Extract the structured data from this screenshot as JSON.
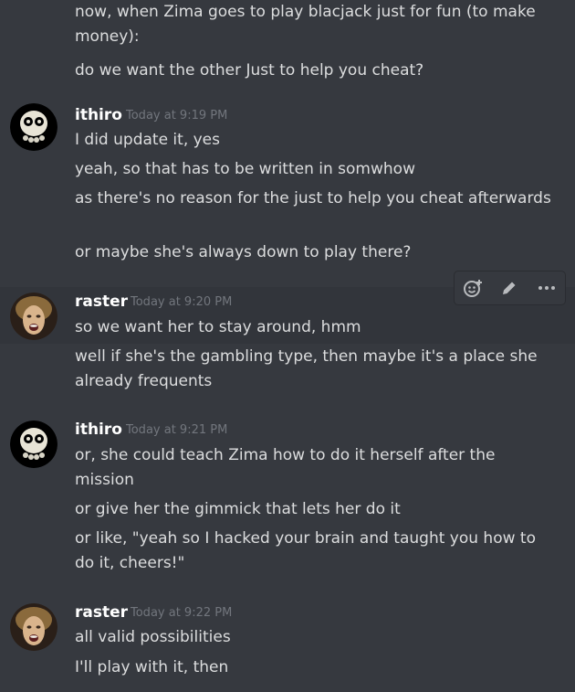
{
  "colors": {
    "background": "#36393f",
    "hover_background": "#32353b",
    "text": "#dcddde",
    "author": "#ffffff",
    "timestamp": "#72767d"
  },
  "messages": [
    {
      "author": "",
      "timestamp": "",
      "lines": [
        "now, when Zima goes to play blacjack just for fun (to make money):",
        "do we want the other Just to help you cheat?"
      ]
    },
    {
      "author": "ithiro",
      "timestamp": "Today at 9:19 PM",
      "avatar": "skull-avatar",
      "lines": [
        "I did update it, yes",
        "yeah, so that has to be written in somwhow",
        "as there's no reason for the just to help you cheat afterwards",
        "or maybe she's always down to play there?"
      ]
    },
    {
      "author": "raster",
      "timestamp": "Today at 9:20 PM",
      "avatar": "face-avatar",
      "lines": [
        "so we want her to stay around, hmm",
        "well if she's the gambling type, then maybe it's a place she already frequents"
      ]
    },
    {
      "author": "ithiro",
      "timestamp": "Today at 9:21 PM",
      "avatar": "skull-avatar",
      "lines": [
        "or, she could teach Zima how to do it herself after the mission",
        "or give her the gimmick that lets her do it",
        "or like, \"yeah so I hacked your brain and taught you how to do it, cheers!\""
      ]
    },
    {
      "author": "raster",
      "timestamp": "Today at 9:22 PM",
      "avatar": "face-avatar",
      "lines": [
        "all valid possibilities",
        "I'll play with it, then"
      ]
    }
  ],
  "toolbar": {
    "icons": [
      "add-reaction-icon",
      "edit-pencil-icon",
      "more-options-icon"
    ]
  }
}
